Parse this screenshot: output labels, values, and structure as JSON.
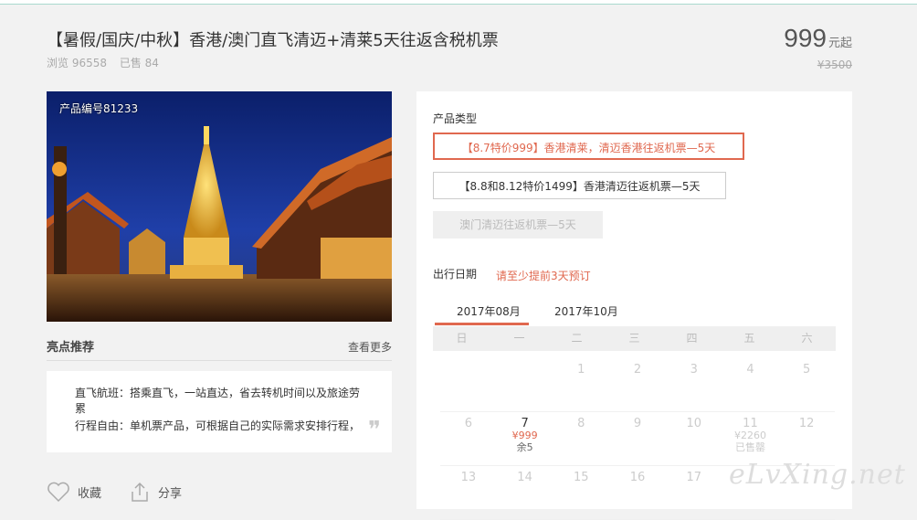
{
  "product": {
    "title": "【暑假/国庆/中秋】香港/澳门直飞清迈+清莱5天往返含税机票",
    "views_label": "浏览 96558",
    "sold_label": "已售 84",
    "price": "999",
    "price_unit": "元起",
    "original_price": "¥3500",
    "code_label": "产品编号81233"
  },
  "highlights": {
    "title": "亮点推荐",
    "more": "查看更多",
    "line1": "直飞航班：搭乘直飞，一站直达，省去转机时间以及旅途劳累",
    "line2": "行程自由：单机票产品，可根据自己的实际需求安排行程，",
    "quote": "❞"
  },
  "actions": {
    "favorite": "收藏",
    "share": "分享"
  },
  "booking": {
    "type_label": "产品类型",
    "options": [
      "【8.7特价999】香港清莱，清迈香港往返机票—5天",
      "【8.8和8.12特价1499】香港清迈往返机票—5天",
      "澳门清迈往返机票—5天"
    ],
    "date_label": "出行日期",
    "date_warning": "请至少提前3天预订",
    "months": [
      "2017年08月",
      "2017年10月"
    ],
    "weekdays": [
      "日",
      "一",
      "二",
      "三",
      "四",
      "五",
      "六"
    ],
    "rows": [
      [
        {
          "day": ""
        },
        {
          "day": ""
        },
        {
          "day": "1"
        },
        {
          "day": "2"
        },
        {
          "day": "3"
        },
        {
          "day": "4"
        },
        {
          "day": "5"
        }
      ],
      [
        {
          "day": "6"
        },
        {
          "day": "7",
          "price": "¥999",
          "stock": "余5",
          "active": true
        },
        {
          "day": "8"
        },
        {
          "day": "9"
        },
        {
          "day": "10"
        },
        {
          "day": "11",
          "price": "¥2260",
          "stock": "已售罄",
          "active": false
        },
        {
          "day": "12"
        }
      ],
      [
        {
          "day": "13"
        },
        {
          "day": "14"
        },
        {
          "day": "15"
        },
        {
          "day": "16"
        },
        {
          "day": "17"
        },
        {
          "day": ""
        },
        {
          "day": ""
        }
      ]
    ]
  },
  "watermark": "eLvXing.net",
  "colors": {
    "accent": "#e0684f",
    "top_line": "#a9d9cf"
  }
}
